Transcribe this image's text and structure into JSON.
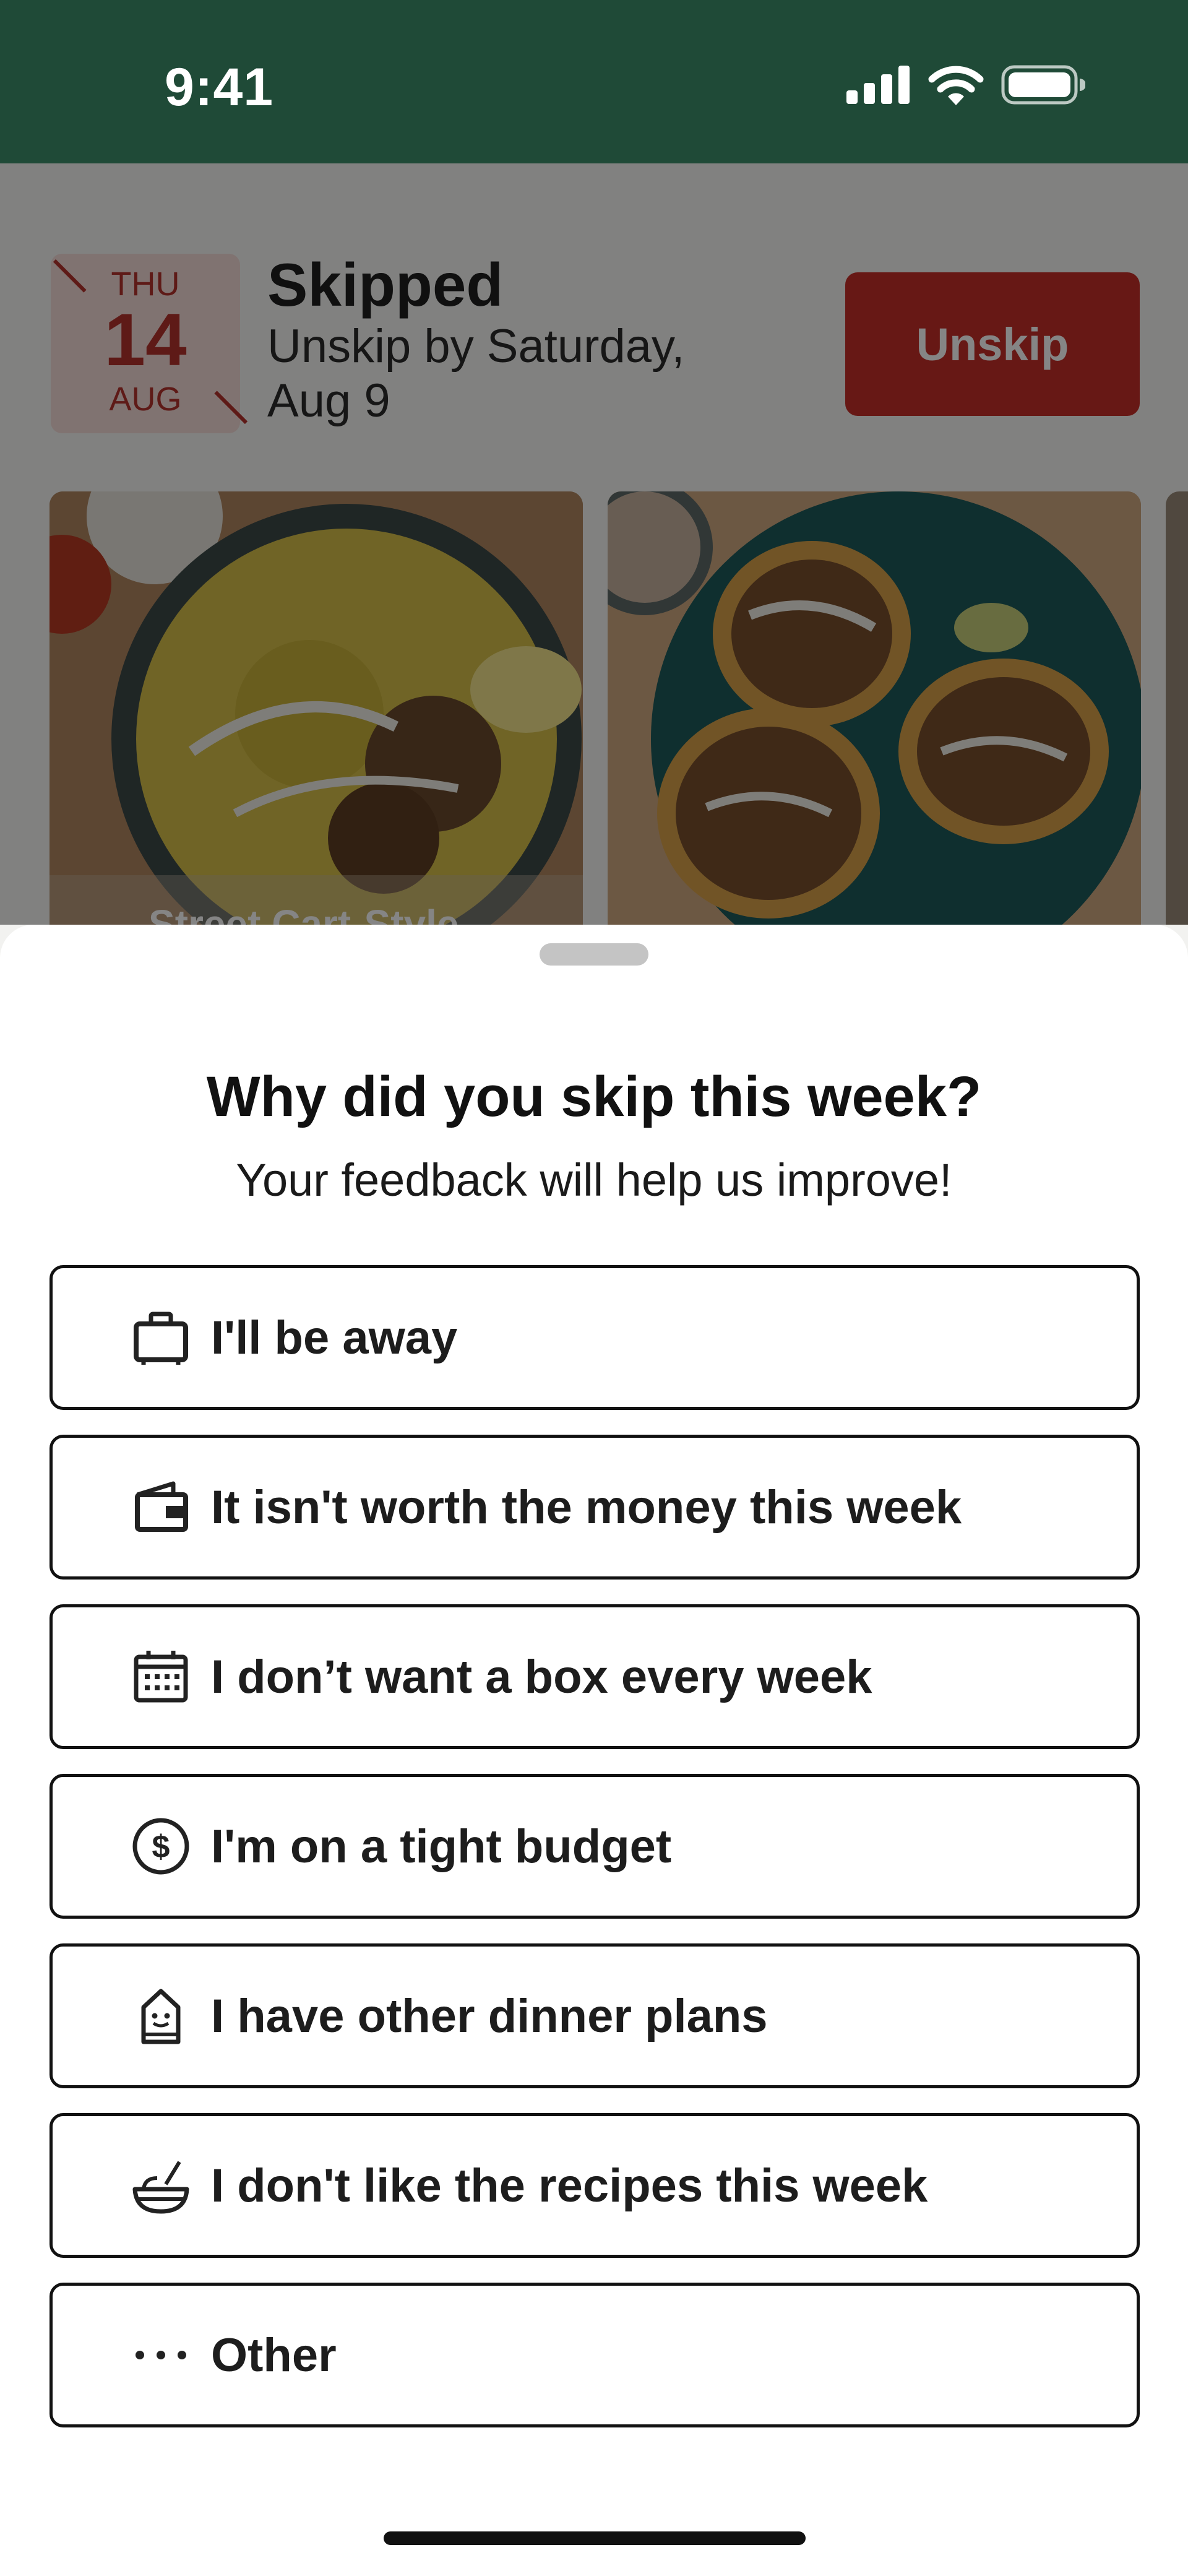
{
  "status_bar": {
    "time": "9:41",
    "icons": [
      "cellular-signal-icon",
      "wifi-icon",
      "battery-icon"
    ],
    "background": "#1f4a37"
  },
  "background_screen": {
    "date": {
      "day_of_week": "THU",
      "day": "14",
      "month": "AUG"
    },
    "status_title": "Skipped",
    "status_subtitle": "Unskip by Saturday, Aug 9",
    "unskip_label": "Unskip",
    "card_label": "Street Cart-Style"
  },
  "sheet": {
    "title": "Why did you skip this week?",
    "subtitle": "Your feedback will help us improve!",
    "options": [
      {
        "icon": "suitcase-icon",
        "label": "I'll be away"
      },
      {
        "icon": "wallet-icon",
        "label": "It isn't worth the money this week"
      },
      {
        "icon": "calendar-icon",
        "label": "I don’t want a box every week"
      },
      {
        "icon": "dollar-coin-icon",
        "label": "I'm on a tight budget"
      },
      {
        "icon": "chef-icon",
        "label": "I have other dinner plans"
      },
      {
        "icon": "bowl-icon",
        "label": "I don't like the recipes this week"
      },
      {
        "icon": "ellipsis-icon",
        "label": "Other"
      }
    ]
  },
  "colors": {
    "brand_green": "#1f4a37",
    "accent_red": "#c62f2a",
    "date_tile_bg": "#f6dcd8"
  }
}
